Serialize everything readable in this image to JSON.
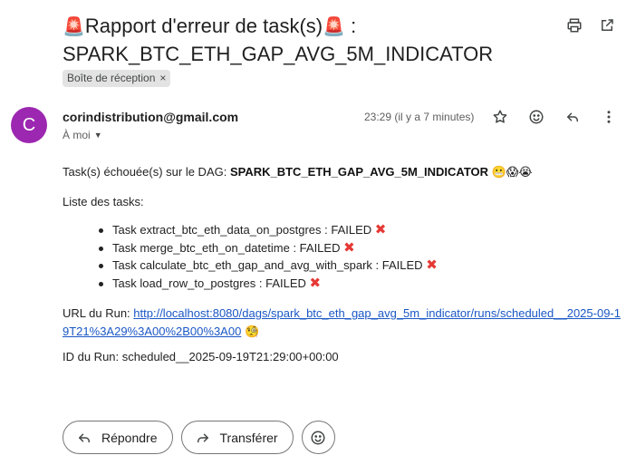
{
  "subject": {
    "siren": "🚨",
    "line1": "Rapport d'erreur de task(s)",
    "suffix": " :",
    "line2": "SPARK_BTC_ETH_GAP_AVG_5M_INDICATOR"
  },
  "label": "Boîte de réception",
  "sender": {
    "initial": "C",
    "email": "corindistribution@gmail.com",
    "to": "À moi",
    "time": "23:29 (il y a 7 minutes)",
    "avatar_color": "#9c27b0"
  },
  "body": {
    "intro": "Task(s) échouée(s) sur le DAG: ",
    "dag": "SPARK_BTC_ETH_GAP_AVG_5M_INDICATOR",
    "intro_emojis": "😬😱😭",
    "tasks_heading": "Liste des tasks:",
    "tasks": [
      {
        "text": "Task extract_btc_eth_data_on_postgres : FAILED",
        "mark": "✖"
      },
      {
        "text": "Task merge_btc_eth_on_datetime : FAILED",
        "mark": "✖"
      },
      {
        "text": "Task calculate_btc_eth_gap_and_avg_with_spark : FAILED",
        "mark": "✖"
      },
      {
        "text": "Task load_row_to_postgres : FAILED",
        "mark": "✖"
      }
    ],
    "url_label": "URL du Run: ",
    "url": "http://localhost:8080/dags/spark_btc_eth_gap_avg_5m_indicator/runs/scheduled__2025-09-19T21%3A29%3A00%2B00%3A00",
    "url_emoji": "🧐",
    "run_id": "ID du Run: scheduled__2025-09-19T21:29:00+00:00"
  },
  "actions": {
    "reply": "Répondre",
    "forward": "Transférer"
  },
  "icons": {
    "print": "print-icon",
    "open_new": "open-in-new-icon",
    "star": "star-icon",
    "emoji": "emoji-icon",
    "reply": "reply-icon",
    "more": "more-vert-icon",
    "forward": "forward-icon"
  }
}
